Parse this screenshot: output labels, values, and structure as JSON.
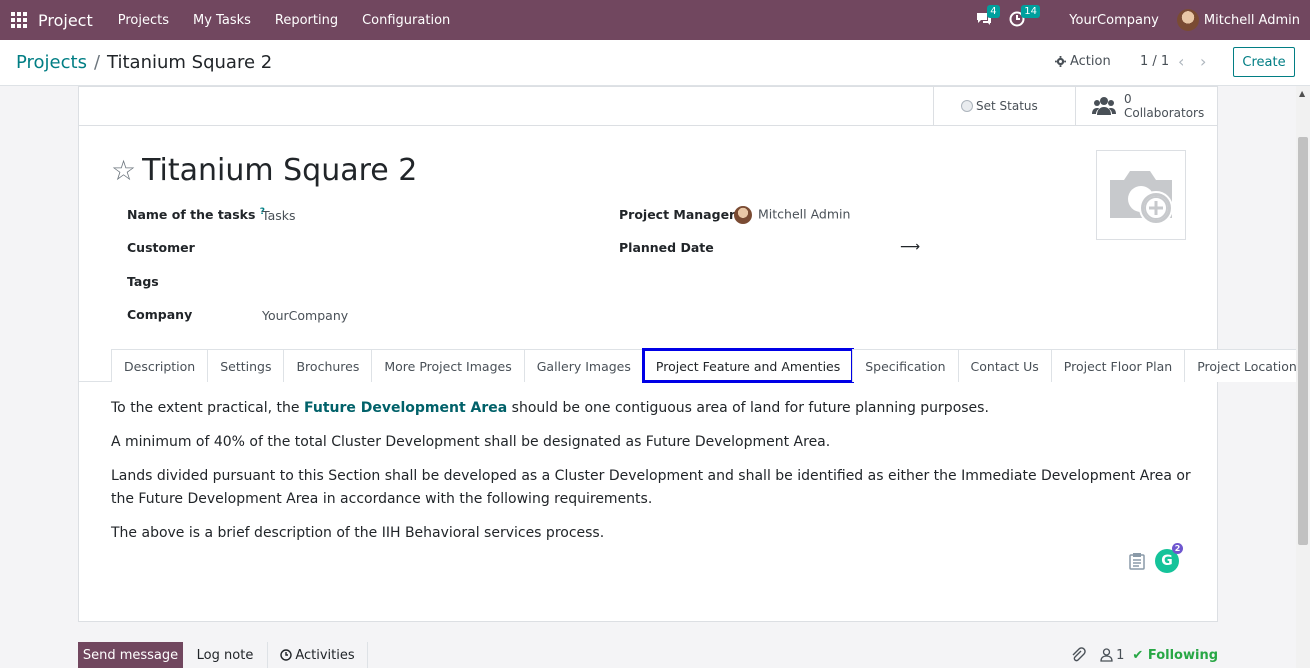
{
  "topbar": {
    "brand": "Project",
    "menu": [
      "Projects",
      "My Tasks",
      "Reporting",
      "Configuration"
    ],
    "messages_count": "4",
    "activities_count": "14",
    "company": "YourCompany",
    "user": "Mitchell Admin"
  },
  "control": {
    "breadcrumb_parent": "Projects",
    "breadcrumb_sep": "/",
    "breadcrumb_current": "Titanium Square 2",
    "action_label": "Action",
    "pager": "1 / 1",
    "create_label": "Create"
  },
  "statusbar": {
    "set_status": "Set Status",
    "collaborators_count": "0",
    "collaborators_label": "Collaborators"
  },
  "record": {
    "title": "Titanium Square 2",
    "fields": {
      "task_name_label": "Name of the tasks",
      "task_name_help": "?",
      "task_name_value": "Tasks",
      "customer_label": "Customer",
      "tags_label": "Tags",
      "company_label": "Company",
      "company_value": "YourCompany",
      "pm_label": "Project Manager",
      "pm_value": "Mitchell Admin",
      "planned_date_label": "Planned Date"
    }
  },
  "tabs": [
    "Description",
    "Settings",
    "Brochures",
    "More Project Images",
    "Gallery Images",
    "Project Feature and Amenties",
    "Specification",
    "Contact Us",
    "Project Floor Plan",
    "Project Location Plan"
  ],
  "content": {
    "p1_pre": "To the extent practical, the ",
    "p1_bold": "Future Development Area",
    "p1_post": " should be one contiguous area of land for future planning purposes.",
    "p2": " A minimum of 40% of the total Cluster Development shall be designated as Future Development Area.",
    "p3": "Lands divided pursuant to this Section shall be developed as a Cluster Development and shall be identified as either the Immediate Development Area or the Future Development Area in accordance with the following requirements.",
    "p4": "The above is a brief description of the IIH Behavioral services process.",
    "grammarly_badge": "2"
  },
  "chatter": {
    "send_message": "Send message",
    "log_note": "Log note",
    "activities": "Activities",
    "followers_count": "1",
    "following": "Following"
  },
  "colors": {
    "topbar": "#71475f",
    "link": "#017e84",
    "highlight": "#0000e6",
    "following": "#28a745"
  }
}
